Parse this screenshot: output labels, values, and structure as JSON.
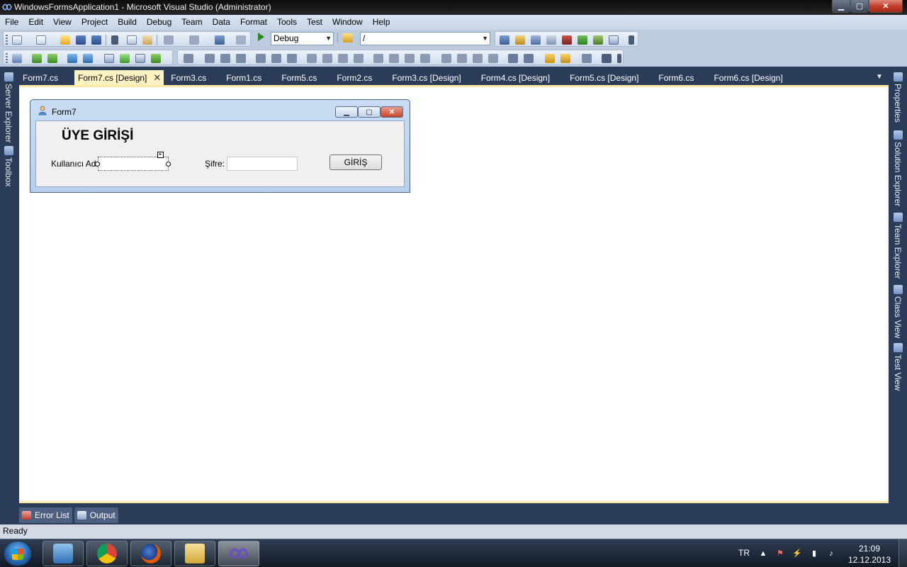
{
  "window": {
    "title": "WindowsFormsApplication1 - Microsoft Visual Studio (Administrator)",
    "min_glyph": "▁",
    "max_glyph": "▢",
    "close_glyph": "✕"
  },
  "menu": [
    "File",
    "Edit",
    "View",
    "Project",
    "Build",
    "Debug",
    "Team",
    "Data",
    "Format",
    "Tools",
    "Test",
    "Window",
    "Help"
  ],
  "toolbar": {
    "config_select": "Debug",
    "platform_select": "/"
  },
  "side_panels": {
    "left": [
      "Server Explorer",
      "Toolbox"
    ],
    "right": [
      "Properties",
      "Solution Explorer",
      "Team Explorer",
      "Class View",
      "Test View"
    ]
  },
  "doc_tabs": {
    "first": "Form7.cs",
    "active": "Form7.cs [Design]",
    "close_glyph": "✕",
    "rest": [
      "Form3.cs",
      "Form1.cs",
      "Form5.cs",
      "Form2.cs",
      "Form3.cs [Design]",
      "Form4.cs [Design]",
      "Form5.cs [Design]",
      "Form6.cs",
      "Form6.cs [Design]"
    ],
    "menu_glyph": "▼"
  },
  "form": {
    "title": "Form7",
    "heading": "ÜYE GİRİŞİ",
    "username_label": "Kullanıcı Adı:",
    "password_label": "Şifre:",
    "username_value": "",
    "password_value": "",
    "login_button": "GİRİŞ"
  },
  "bottom_tabs": [
    "Error List",
    "Output"
  ],
  "status": "Ready",
  "taskbar": {
    "language": "TR",
    "time": "21:09",
    "date": "12.12.2013"
  },
  "colors": {
    "accent_tab": "#fff3c4",
    "ide_background": "#2b3c59",
    "toolbar_background": "#bccbde"
  }
}
